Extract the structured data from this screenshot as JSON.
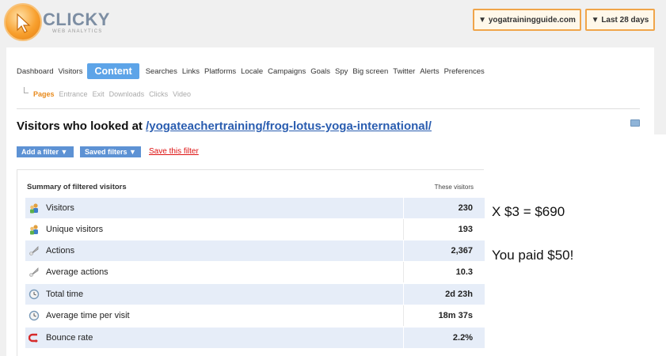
{
  "logo": {
    "name": "CLICKY",
    "tagline": "WEB ANALYTICS"
  },
  "header": {
    "site_dropdown": "▼ yogatrainingguide.com",
    "range_dropdown": "▼ Last 28 days"
  },
  "nav": {
    "items": [
      {
        "label": "Dashboard"
      },
      {
        "label": "Visitors"
      },
      {
        "label": "Content",
        "active": true
      },
      {
        "label": "Searches"
      },
      {
        "label": "Links"
      },
      {
        "label": "Platforms"
      },
      {
        "label": "Locale"
      },
      {
        "label": "Campaigns"
      },
      {
        "label": "Goals"
      },
      {
        "label": "Spy"
      },
      {
        "label": "Big screen"
      },
      {
        "label": "Twitter"
      },
      {
        "label": "Alerts"
      },
      {
        "label": "Preferences"
      }
    ]
  },
  "subnav": {
    "items": [
      {
        "label": "Pages",
        "active": true
      },
      {
        "label": "Entrance"
      },
      {
        "label": "Exit"
      },
      {
        "label": "Downloads"
      },
      {
        "label": "Clicks"
      },
      {
        "label": "Video"
      }
    ]
  },
  "page": {
    "heading_prefix": "Visitors who looked at ",
    "heading_link": "/yogateachertraining/frog-lotus-yoga-international/"
  },
  "filters": {
    "add_filter": "Add a filter ▼",
    "saved_filters": "Saved filters ▼",
    "save_filter": "Save this filter"
  },
  "summary": {
    "title": "Summary of filtered visitors",
    "column": "These visitors",
    "rows": [
      {
        "label": "Visitors",
        "value": "230",
        "icon": "visitors-icon"
      },
      {
        "label": "Unique visitors",
        "value": "193",
        "icon": "unique-visitors-icon"
      },
      {
        "label": "Actions",
        "value": "2,367",
        "icon": "actions-icon"
      },
      {
        "label": "Average actions",
        "value": "10.3",
        "icon": "average-actions-icon"
      },
      {
        "label": "Total time",
        "value": "2d 23h",
        "icon": "clock-icon"
      },
      {
        "label": "Average time per visit",
        "value": "18m 37s",
        "icon": "clock-icon"
      },
      {
        "label": "Bounce rate",
        "value": "2.2%",
        "icon": "bounce-icon"
      }
    ]
  },
  "annotations": {
    "line1": "X $3 = $690",
    "line2": "You paid $50!"
  },
  "colors": {
    "accent": "#5da4e8",
    "active_subnav": "#e88a1c",
    "dropdown_border": "#f0a54a",
    "row_shade": "#e6edf8",
    "link": "#2a5db0",
    "save_link": "#dd1111"
  }
}
